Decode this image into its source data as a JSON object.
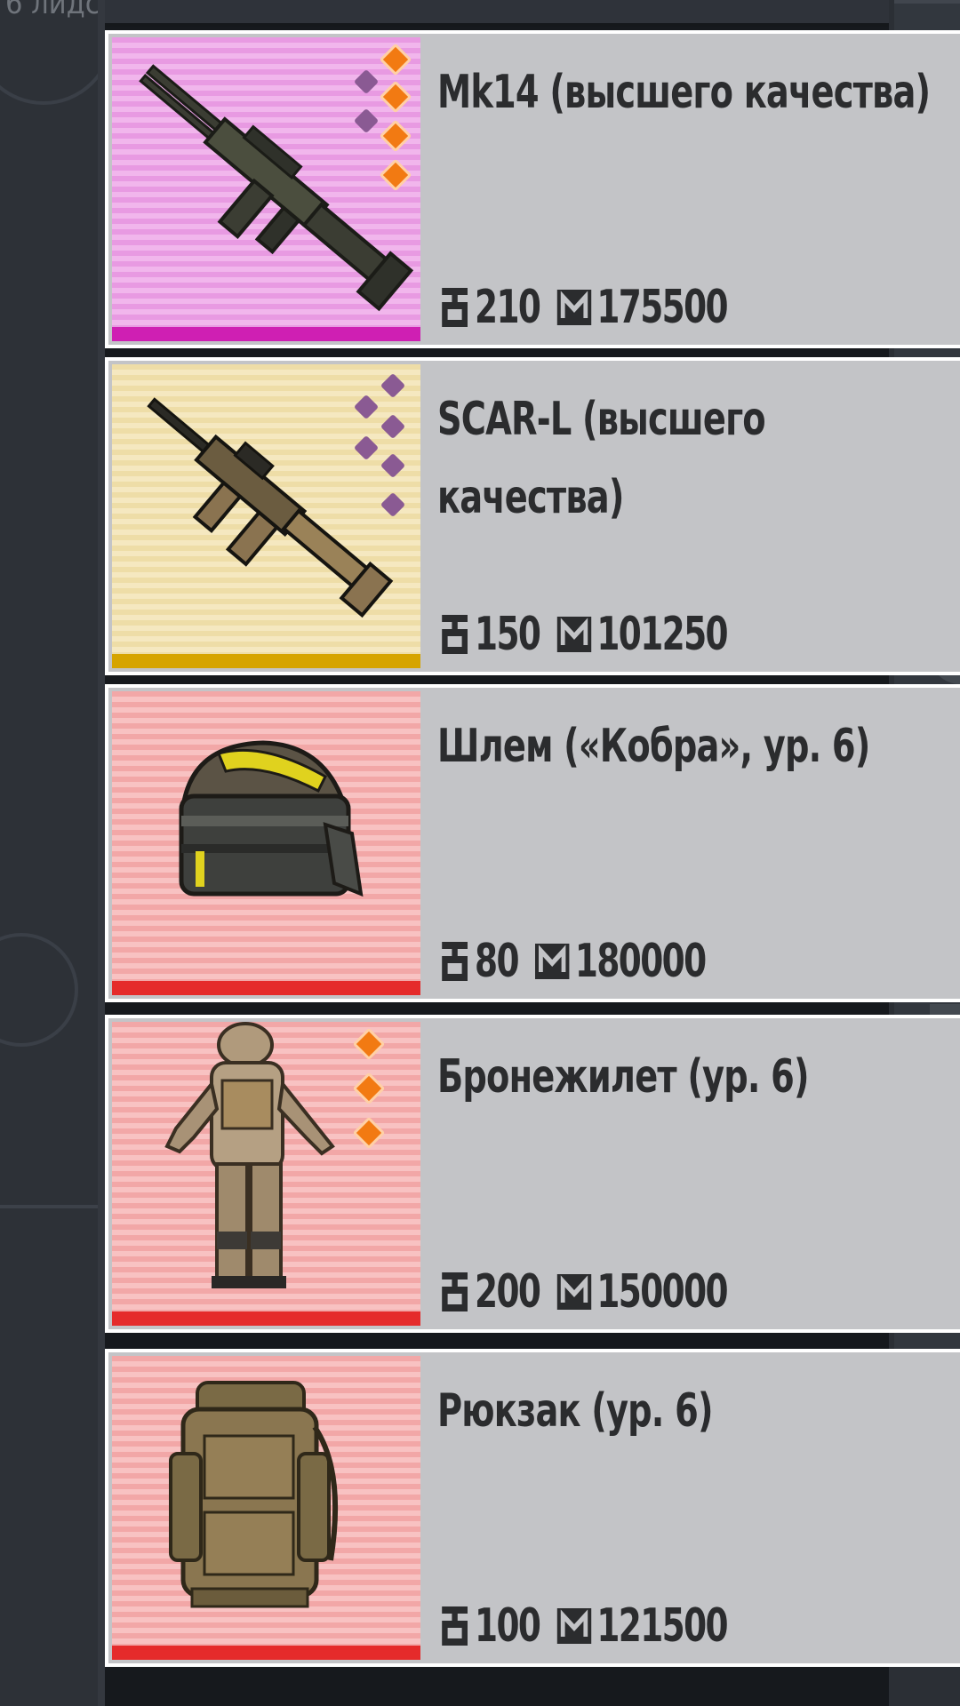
{
  "corner_label": "6 лидс",
  "items": [
    {
      "name": "Mk14 (высшего качества)",
      "weight": "210",
      "price": "175500",
      "rarity_color": "#e89ae2",
      "art_icon": "rifle-icon",
      "attachments": [
        "orange",
        "orange",
        "orange",
        "orange",
        "purple",
        "purple"
      ]
    },
    {
      "name": "SCAR-L (высшего качества)",
      "weight": "150",
      "price": "101250",
      "rarity_color": "#eedda7",
      "art_icon": "assault-rifle-icon",
      "attachments": [
        "purple",
        "purple",
        "purple",
        "purple",
        "purple",
        "purple"
      ]
    },
    {
      "name": "Шлем («Кобра», ур. 6)",
      "weight": "80",
      "price": "180000",
      "rarity_color": "#f2a7a7",
      "art_icon": "helmet-icon",
      "attachments": []
    },
    {
      "name": "Бронежилет (ур. 6)",
      "weight": "200",
      "price": "150000",
      "rarity_color": "#f2a7a7",
      "art_icon": "armor-suit-icon",
      "attachments": [
        "orange",
        "orange",
        "orange"
      ]
    },
    {
      "name": "Рюкзак (ур. 6)",
      "weight": "100",
      "price": "121500",
      "rarity_color": "#f2a7a7",
      "art_icon": "backpack-icon",
      "attachments": []
    }
  ],
  "icons": {
    "weight": "weight-icon",
    "money": "money-icon"
  }
}
